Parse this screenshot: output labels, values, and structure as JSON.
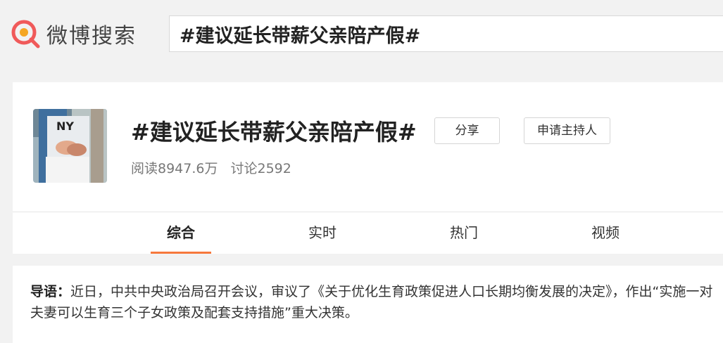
{
  "header": {
    "logo_text": "微博搜索",
    "search_value": "#建议延长带薪父亲陪产假#"
  },
  "topic": {
    "title": "#建议延长带薪父亲陪产假#",
    "share_label": "分享",
    "host_label": "申请主持人",
    "reads": "阅读8947.6万",
    "discussions": "讨论2592",
    "cover_overlay_text": "NY"
  },
  "tabs": [
    {
      "label": "综合",
      "active": true
    },
    {
      "label": "实时",
      "active": false
    },
    {
      "label": "热门",
      "active": false
    },
    {
      "label": "视频",
      "active": false
    }
  ],
  "intro": {
    "label": "导语：",
    "text": "近日，中共中央政治局召开会议，审议了《关于优化生育政策促进人口长期均衡发展的决定》，作出“实施一对夫妻可以生育三个子女政策及配套支持措施”重大决策。"
  },
  "colors": {
    "accent": "#f6783c",
    "logo_red": "#f05a5a",
    "logo_orange": "#f5a623"
  }
}
